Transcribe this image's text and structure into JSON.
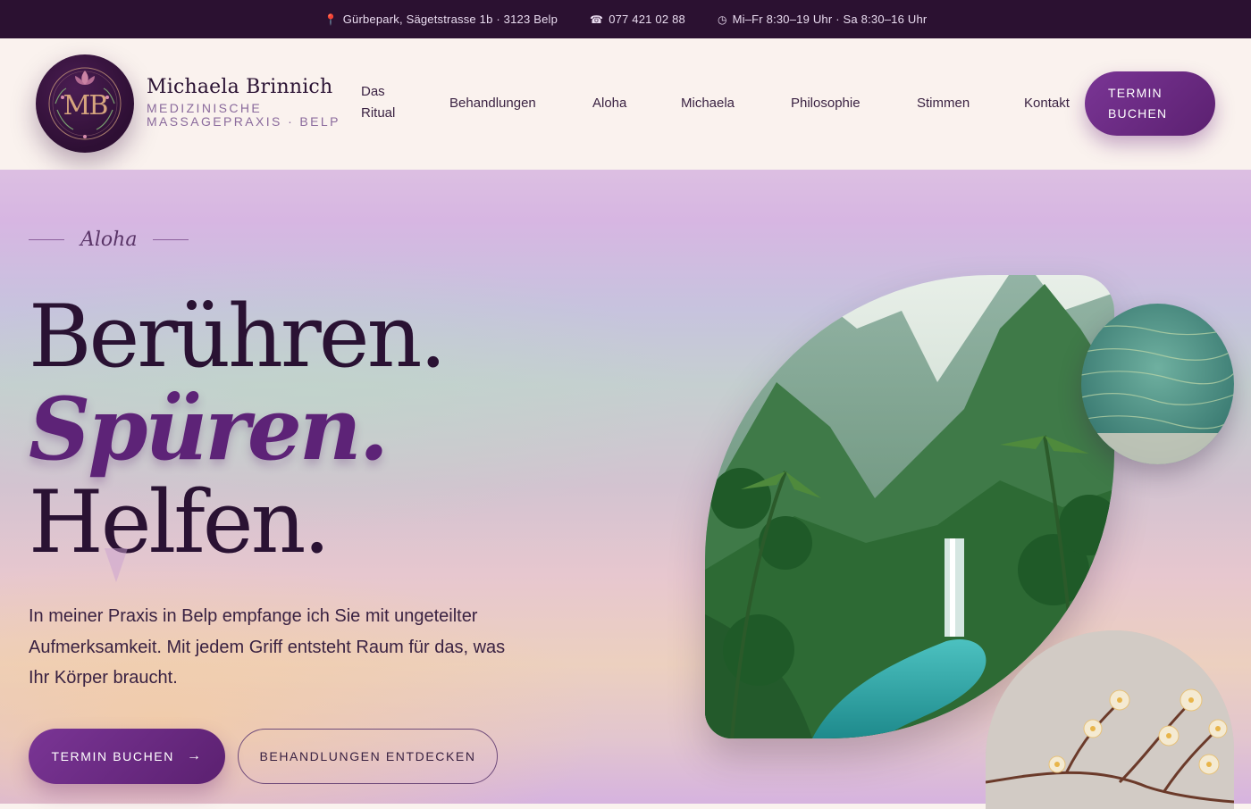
{
  "topbar": {
    "address": "Gürbepark, Sägetstrasse 1b · 3123 Belp",
    "phone": "077 421 02 88",
    "hours": "Mi–Fr 8:30–19 Uhr · Sa 8:30–16 Uhr",
    "icons": [
      "map-pin-icon",
      "phone-icon",
      "clock-icon"
    ]
  },
  "header": {
    "logo_text": "MB",
    "brand_name": "Michaela Brinnich",
    "brand_sub": "Medizinische Massagepraxis · Belp",
    "nav": {
      "ritual_line1": "Das",
      "ritual_line2": "Ritual",
      "behandlungen": "Behandlungen",
      "aloha": "Aloha",
      "michaela": "Michaela",
      "philosophie": "Philosophie",
      "stimmen": "Stimmen",
      "kontakt": "Kontakt"
    },
    "cta_line1": "TERMIN",
    "cta_line2": "BUCHEN"
  },
  "hero": {
    "eyebrow": "Aloha",
    "line1": "Berühren.",
    "line2": "Spüren.",
    "line3": "Helfen.",
    "lead": "In meiner Praxis in Belp empfange ich Sie mit ungeteilter Aufmerksamkeit. Mit jedem Griff entsteht Raum für das, was Ihr Körper braucht.",
    "primary_cta": "TERMIN BUCHEN",
    "secondary_cta": "BEHANDLUNGEN ENTDECKEN"
  },
  "colors": {
    "topbar_bg": "#2b1131",
    "brand_purple": "#5d2377",
    "accent_gradient_start": "#7a3595"
  }
}
